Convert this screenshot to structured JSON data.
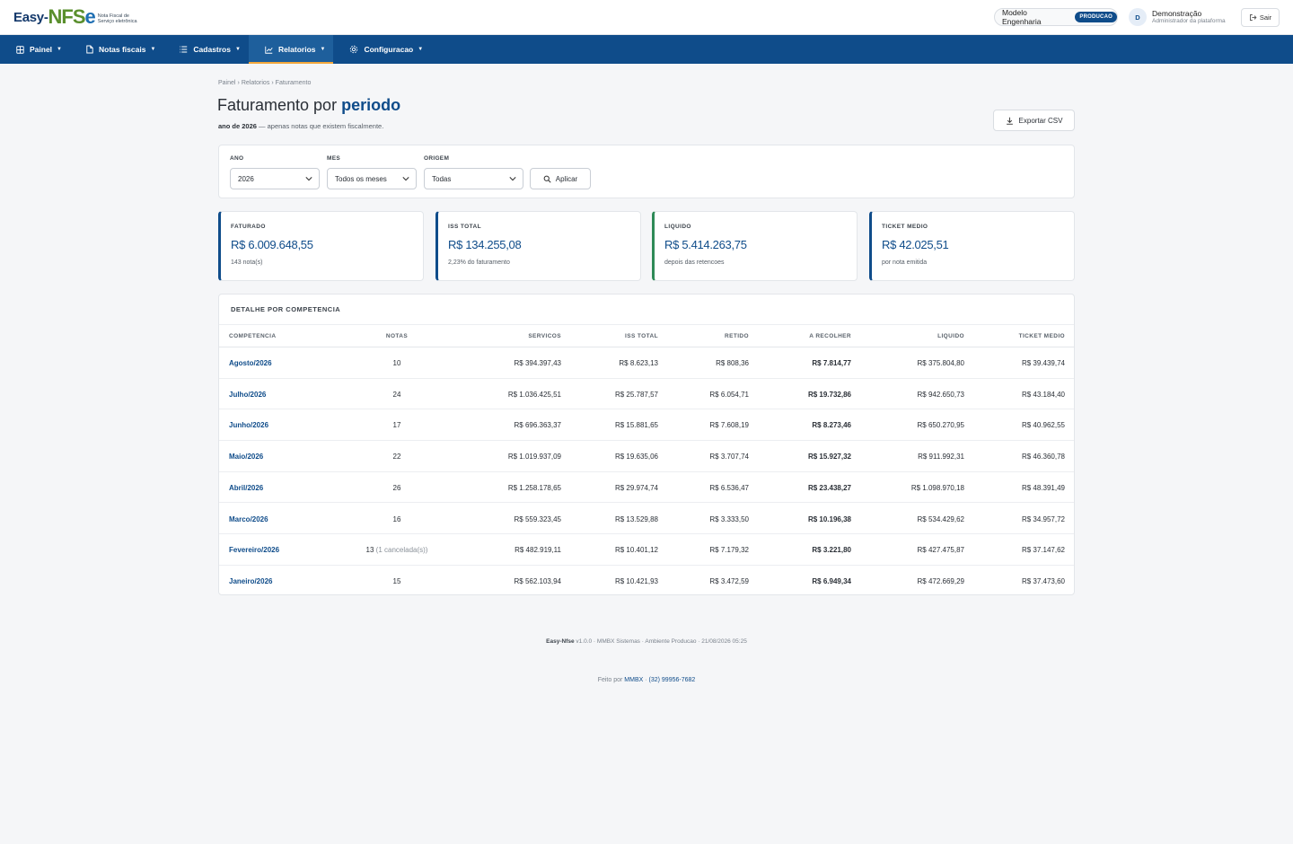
{
  "brand": {
    "logo_prefix": "Easy-",
    "logo_nf": "NFS",
    "logo_e": "e",
    "tagline_line1": "Nota Fiscal de",
    "tagline_line2": "Serviço eletrônica"
  },
  "header": {
    "company": "Modelo Engenharia",
    "environment_badge": "PRODUCAO",
    "user_initial": "D",
    "user_name": "Demonstração",
    "user_role": "Administrador da plataforma",
    "logout_label": "Sair"
  },
  "nav": {
    "items": [
      {
        "label": "Painel",
        "icon": "dashboard-icon"
      },
      {
        "label": "Notas fiscais",
        "icon": "document-icon"
      },
      {
        "label": "Cadastros",
        "icon": "list-icon"
      },
      {
        "label": "Relatorios",
        "icon": "chart-icon",
        "active": true
      },
      {
        "label": "Configuracao",
        "icon": "gear-icon"
      }
    ],
    "caret": "▼",
    "active_color": "#f3a73b"
  },
  "breadcrumb": [
    "Painel",
    "Relatorios",
    "Faturamento"
  ],
  "breadcrumb_sep": "›",
  "page": {
    "title_prefix": "Faturamento por ",
    "title_emphasis": "periodo",
    "subtitle_bold": "ano de 2026",
    "subtitle_rest": " — apenas notas que existem fiscalmente.",
    "export_label": "Exportar CSV"
  },
  "filters": {
    "year_label": "ANO",
    "year_value": "2026",
    "month_label": "MES",
    "month_value": "Todos os meses",
    "origin_label": "ORIGEM",
    "origin_value": "Todas",
    "apply_label": "Aplicar"
  },
  "cards": [
    {
      "label": "FATURADO",
      "value": "R$ 6.009.648,55",
      "sub": "143 nota(s)",
      "accent": "#0f4c8a"
    },
    {
      "label": "ISS TOTAL",
      "value": "R$ 134.255,08",
      "sub": "2,23% do faturamento",
      "accent": "#0f4c8a"
    },
    {
      "label": "LIQUIDO",
      "value": "R$ 5.414.263,75",
      "sub": "depois das retencoes",
      "accent": "#2e8a57"
    },
    {
      "label": "TICKET MEDIO",
      "value": "R$ 42.025,51",
      "sub": "por nota emitida",
      "accent": "#0f4c8a"
    }
  ],
  "table": {
    "title": "DETALHE POR COMPETENCIA",
    "columns": [
      "COMPETENCIA",
      "NOTAS",
      "SERVICOS",
      "ISS TOTAL",
      "RETIDO",
      "A RECOLHER",
      "LIQUIDO",
      "TICKET MEDIO"
    ],
    "rows": [
      {
        "competencia": "Agosto/2026",
        "notas": "10",
        "notas_extra": "",
        "servicos": "R$ 394.397,43",
        "iss": "R$ 8.623,13",
        "retido": "R$ 808,36",
        "recolher": "R$ 7.814,77",
        "liquido": "R$ 375.804,80",
        "ticket": "R$ 39.439,74"
      },
      {
        "competencia": "Julho/2026",
        "notas": "24",
        "notas_extra": "",
        "servicos": "R$ 1.036.425,51",
        "iss": "R$ 25.787,57",
        "retido": "R$ 6.054,71",
        "recolher": "R$ 19.732,86",
        "liquido": "R$ 942.650,73",
        "ticket": "R$ 43.184,40"
      },
      {
        "competencia": "Junho/2026",
        "notas": "17",
        "notas_extra": "",
        "servicos": "R$ 696.363,37",
        "iss": "R$ 15.881,65",
        "retido": "R$ 7.608,19",
        "recolher": "R$ 8.273,46",
        "liquido": "R$ 650.270,95",
        "ticket": "R$ 40.962,55"
      },
      {
        "competencia": "Maio/2026",
        "notas": "22",
        "notas_extra": "",
        "servicos": "R$ 1.019.937,09",
        "iss": "R$ 19.635,06",
        "retido": "R$ 3.707,74",
        "recolher": "R$ 15.927,32",
        "liquido": "R$ 911.992,31",
        "ticket": "R$ 46.360,78"
      },
      {
        "competencia": "Abril/2026",
        "notas": "26",
        "notas_extra": "",
        "servicos": "R$ 1.258.178,65",
        "iss": "R$ 29.974,74",
        "retido": "R$ 6.536,47",
        "recolher": "R$ 23.438,27",
        "liquido": "R$ 1.098.970,18",
        "ticket": "R$ 48.391,49"
      },
      {
        "competencia": "Marco/2026",
        "notas": "16",
        "notas_extra": "",
        "servicos": "R$ 559.323,45",
        "iss": "R$ 13.529,88",
        "retido": "R$ 3.333,50",
        "recolher": "R$ 10.196,38",
        "liquido": "R$ 534.429,62",
        "ticket": "R$ 34.957,72"
      },
      {
        "competencia": "Fevereiro/2026",
        "notas": "13",
        "notas_extra": "(1 cancelada(s))",
        "servicos": "R$ 482.919,11",
        "iss": "R$ 10.401,12",
        "retido": "R$ 7.179,32",
        "recolher": "R$ 3.221,80",
        "liquido": "R$ 427.475,87",
        "ticket": "R$ 37.147,62"
      },
      {
        "competencia": "Janeiro/2026",
        "notas": "15",
        "notas_extra": "",
        "servicos": "R$ 562.103,94",
        "iss": "R$ 10.421,93",
        "retido": "R$ 3.472,59",
        "recolher": "R$ 6.949,34",
        "liquido": "R$ 472.669,29",
        "ticket": "R$ 37.473,60"
      }
    ]
  },
  "footer": {
    "app_name": "Easy-Nfse",
    "version_info": " v1.0.0 · MMBX Sistemas · Ambiente Producao · 21/08/2026 05:25",
    "made_by_prefix": "Feito por ",
    "made_by_link": "MMBX",
    "separator": " · ",
    "phone": "(32) 99956-7682"
  }
}
